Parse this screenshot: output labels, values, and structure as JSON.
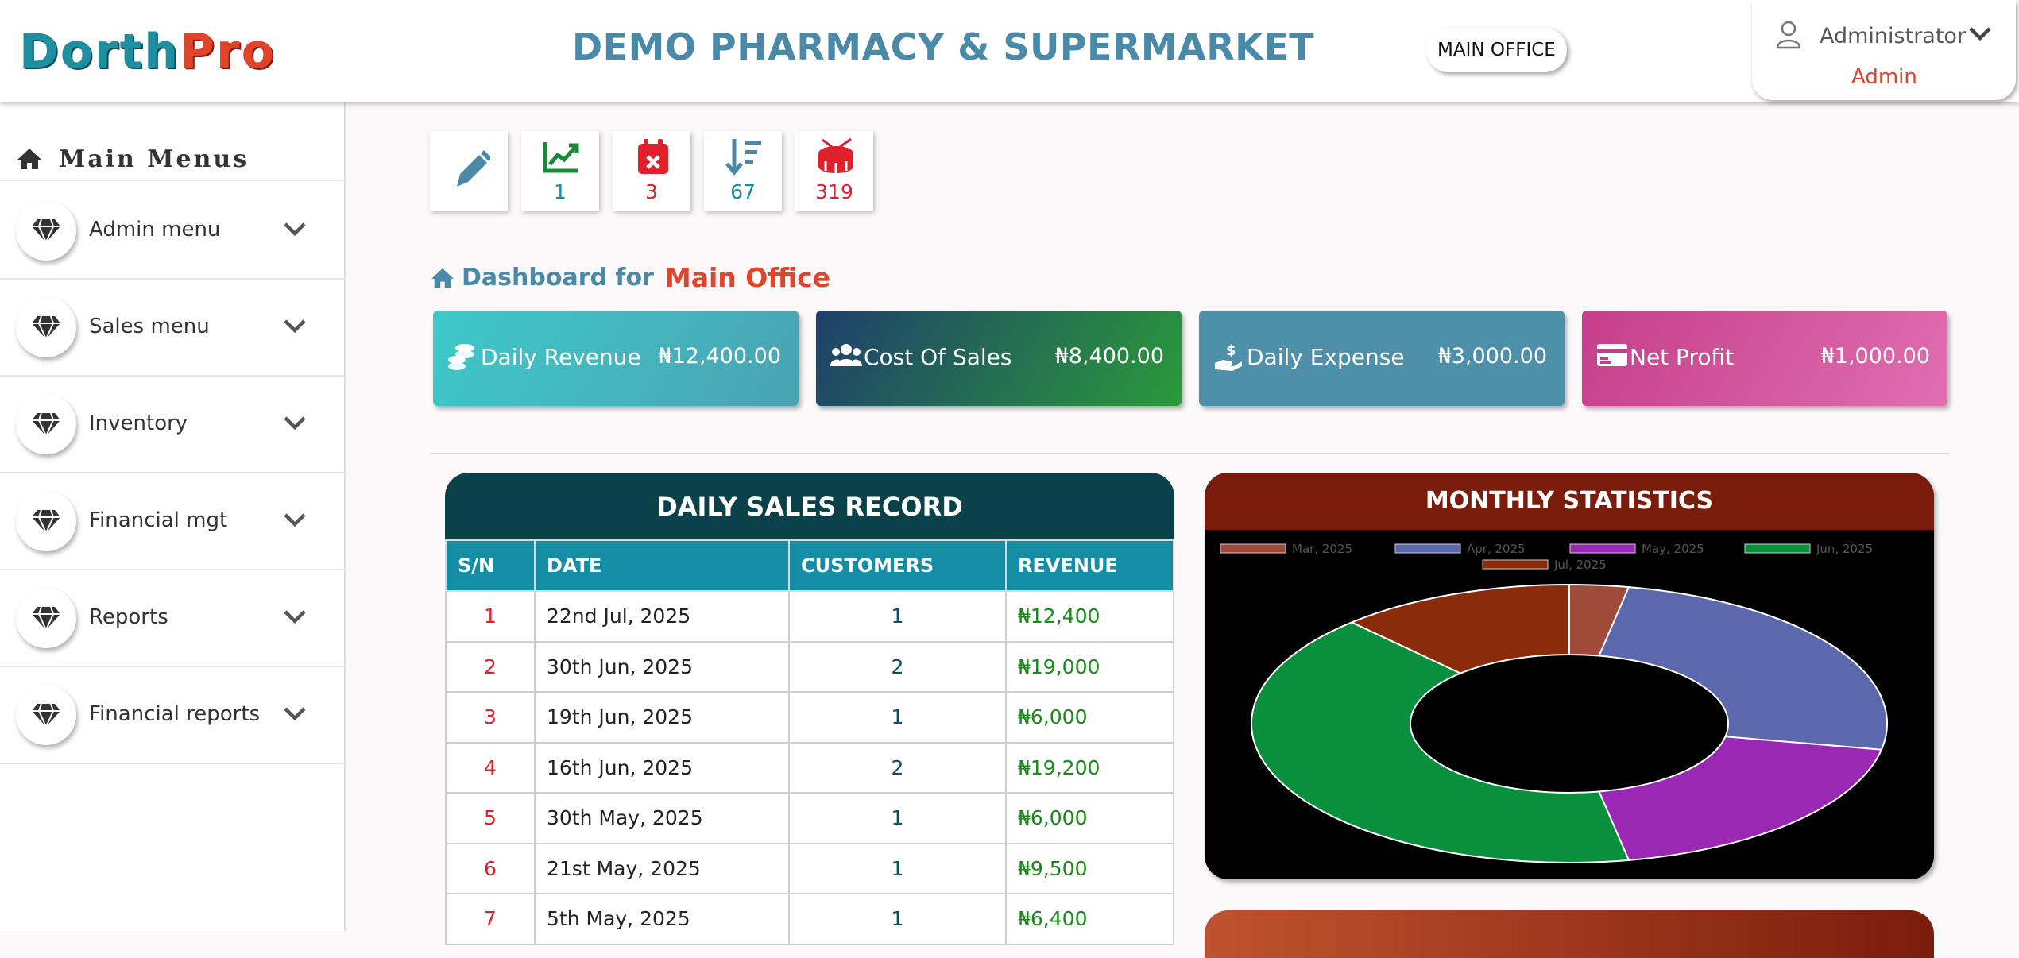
{
  "header": {
    "logo_part1": "Dorth",
    "logo_part2": "Pro",
    "site_title": "DEMO PHARMACY & SUPERMARKET",
    "office_button": "MAIN OFFICE",
    "user_name": "Administrator",
    "user_role": "Admin"
  },
  "sidebar": {
    "heading": "Main Menus",
    "items": [
      {
        "label": "Admin menu"
      },
      {
        "label": "Sales menu"
      },
      {
        "label": "Inventory"
      },
      {
        "label": "Financial mgt"
      },
      {
        "label": "Reports"
      },
      {
        "label": "Financial reports"
      }
    ]
  },
  "quick": [
    {
      "icon": "pencil-icon",
      "count": ""
    },
    {
      "icon": "chart-line-icon",
      "count": "1"
    },
    {
      "icon": "calendar-x-icon",
      "count": "3"
    },
    {
      "icon": "sort-down-icon",
      "count": "67"
    },
    {
      "icon": "drum-icon",
      "count": "319"
    }
  ],
  "dashboard": {
    "title_prefix": "Dashboard for",
    "title_office": "Main Office"
  },
  "stats": [
    {
      "label": "Daily Revenue",
      "value": "₦12,400.00",
      "icon": "coins-icon"
    },
    {
      "label": "Cost Of Sales",
      "value": "₦8,400.00",
      "icon": "users-icon"
    },
    {
      "label": "Daily Expense",
      "value": "₦3,000.00",
      "icon": "hand-dollar-icon"
    },
    {
      "label": "Net Profit",
      "value": "₦1,000.00",
      "icon": "credit-card-icon"
    }
  ],
  "sales_table": {
    "title": "DAILY SALES RECORD",
    "columns": [
      "S/N",
      "DATE",
      "CUSTOMERS",
      "REVENUE"
    ],
    "rows": [
      [
        "1",
        "22nd Jul, 2025",
        "1",
        "₦12,400"
      ],
      [
        "2",
        "30th Jun, 2025",
        "2",
        "₦19,000"
      ],
      [
        "3",
        "19th Jun, 2025",
        "1",
        "₦6,000"
      ],
      [
        "4",
        "16th Jun, 2025",
        "2",
        "₦19,200"
      ],
      [
        "5",
        "30th May, 2025",
        "1",
        "₦6,000"
      ],
      [
        "6",
        "21st May, 2025",
        "1",
        "₦9,500"
      ],
      [
        "7",
        "5th May, 2025",
        "1",
        "₦6,400"
      ]
    ]
  },
  "monthly_chart": {
    "title": "MONTHLY STATISTICS"
  },
  "chart_data": {
    "type": "pie",
    "title": "MONTHLY STATISTICS",
    "categories": [
      "Mar, 2025",
      "Apr, 2025",
      "May, 2025",
      "Jun, 2025",
      "Jul, 2025"
    ],
    "values": [
      3,
      25,
      19,
      41,
      12
    ],
    "colors": [
      "#a04a3c",
      "#5c68ad",
      "#9b27b5",
      "#0a8f3c",
      "#8a2b0a"
    ],
    "donut": true,
    "legend": "top"
  },
  "colors": {
    "accent": "#4a8aa8",
    "brand_red": "#e0442a",
    "table_header": "#158da5"
  }
}
